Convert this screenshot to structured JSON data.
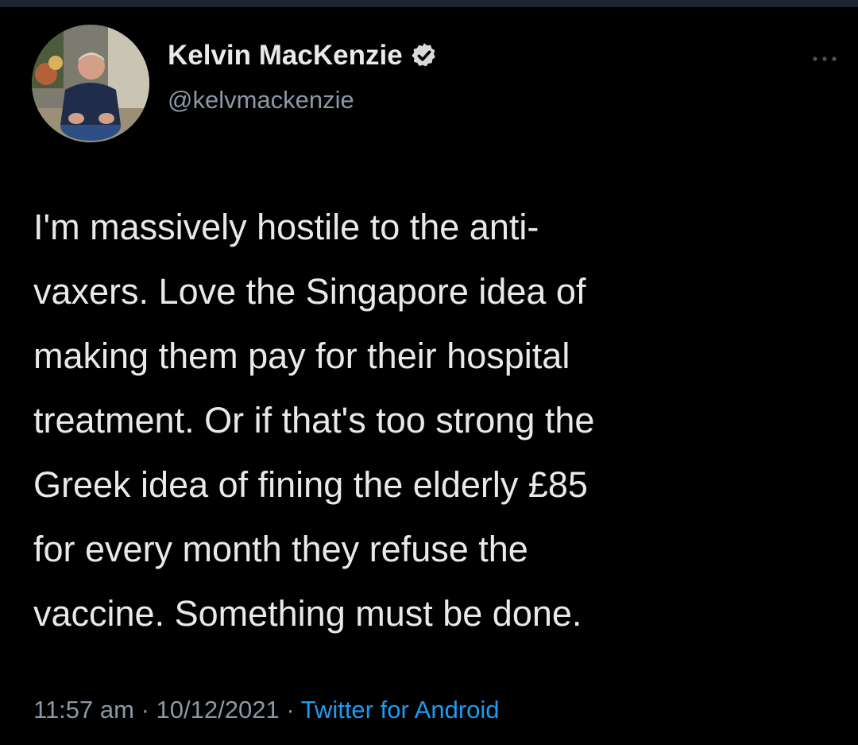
{
  "tweet": {
    "author": {
      "display_name": "Kelvin MacKenzie",
      "handle": "@kelvmackenzie",
      "verified": true,
      "avatar_icon": "profile-photo",
      "verified_icon": "verified-badge-icon"
    },
    "more_icon": "more-horizontal-icon",
    "text_lines": [
      "I'm massively hostile to the anti-",
      "vaxers. Love the Singapore idea of",
      "making them pay for their hospital",
      "treatment. Or if that's too strong the",
      "Greek idea of fining the elderly £85",
      "for every month they refuse the",
      "vaccine. Something must be done."
    ],
    "time": "11:57 am",
    "separator": "·",
    "date": "10/12/2021",
    "source": "Twitter for Android"
  },
  "colors": {
    "background": "#000000",
    "text_primary": "#e7e9ea",
    "text_secondary": "#8b98a5",
    "accent": "#1d9bf0"
  }
}
